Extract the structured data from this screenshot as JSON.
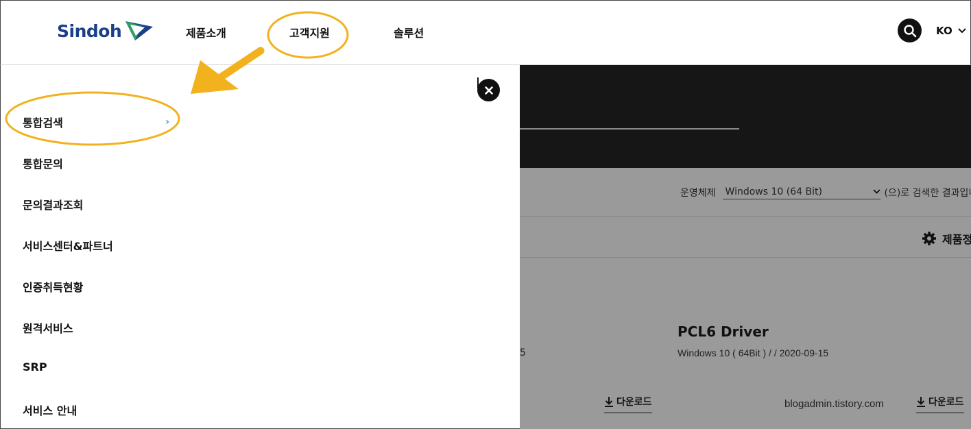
{
  "header": {
    "logo_text": "Sindoh",
    "nav": [
      "제품소개",
      "고객지원",
      "솔루션"
    ],
    "lang": "KO"
  },
  "side_menu": {
    "items": [
      "통합검색",
      "통합문의",
      "문의결과조회",
      "서비스센터&파트너",
      "인증취득현황",
      "원격서비스",
      "SRP",
      "서비스 안내"
    ],
    "selected_chevron": "›"
  },
  "background_page": {
    "os_label": "운영체제",
    "os_value": "Windows 10 (64 Bit)",
    "os_note": "(으)로 검색한 결과입니",
    "product_info": "제품정",
    "driver_title": "PCL6 Driver",
    "driver_meta": "Windows 10 ( 64Bit ) / / 2020-09-15",
    "partial_meta": "5",
    "download_label": "다운로드",
    "watermark": "blogadmin.tistory.com"
  },
  "colors": {
    "logo_blue": "#1c3f8a",
    "logo_green": "#2f9e63",
    "annotation": "#f2b21d",
    "chevron": "#4a90d9"
  },
  "icons": [
    "search-icon",
    "chevron-down-icon",
    "close-icon",
    "gear-icon",
    "download-icon",
    "chevron-right-icon"
  ]
}
